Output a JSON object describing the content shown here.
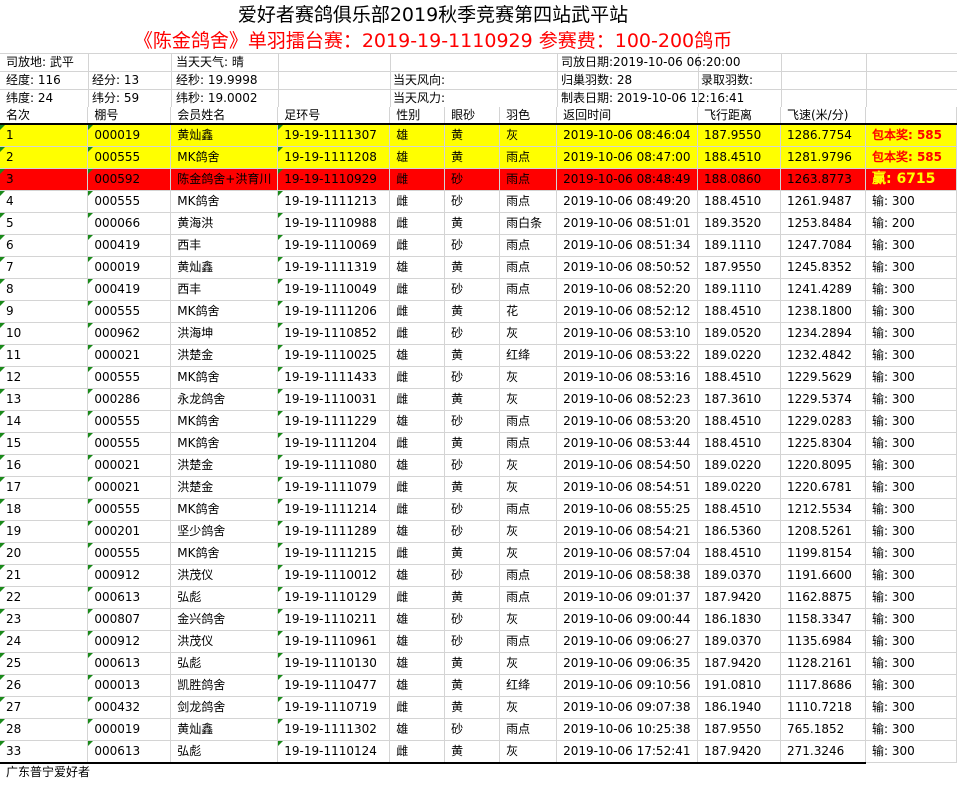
{
  "title": "爱好者赛鸽俱乐部2019秋季竞赛第四站武平站",
  "subtitle": "《陈金鸽舍》单羽擂台赛：2019-19-1110929 参赛费：100-200鸽币",
  "info": {
    "release_place": "司放地: 武平",
    "weather": "当天天气: 晴",
    "release_date": "司放日期:2019-10-06 06:20:00",
    "longitude": "经度: 116",
    "lon_min": "经分: 13",
    "lon_sec": "经秒: 19.9998",
    "wind_dir": "当天风向:",
    "returned": "归巢羽数: 28",
    "recorded": "录取羽数:",
    "latitude": "纬度:  24",
    "lat_min": "纬分: 59",
    "lat_sec": "纬秒: 19.0002",
    "wind_force": "当天风力:",
    "made_date": "制表日期: 2019-10-06 12:16:41"
  },
  "headers": [
    "名次",
    "棚号",
    "会员姓名",
    "足环号",
    "性别",
    "眼砂",
    "羽色",
    "返回时间",
    "飞行距离",
    "飞速(米/分)",
    ""
  ],
  "rows": [
    [
      "1",
      "000019",
      "黄灿鑫",
      "19-19-1111307",
      "雄",
      "黄",
      "灰",
      "2019-10-06 08:46:04",
      "187.9550",
      "1286.7754",
      "包本奖: 585"
    ],
    [
      "2",
      "000555",
      "MK鸽舍",
      "19-19-1111208",
      "雄",
      "黄",
      "雨点",
      "2019-10-06 08:47:00",
      "188.4510",
      "1281.9796",
      "包本奖: 585"
    ],
    [
      "3",
      "000592",
      "陈金鸽舍+洪育川",
      "19-19-1110929",
      "雌",
      "砂",
      "雨点",
      "2019-10-06 08:48:49",
      "188.0860",
      "1263.8773",
      "赢: 6715"
    ],
    [
      "4",
      "000555",
      "MK鸽舍",
      "19-19-1111213",
      "雌",
      "砂",
      "雨点",
      "2019-10-06 08:49:20",
      "188.4510",
      "1261.9487",
      "输: 300"
    ],
    [
      "5",
      "000066",
      "黄海洪",
      "19-19-1110988",
      "雌",
      "黄",
      "雨白条",
      "2019-10-06 08:51:01",
      "189.3520",
      "1253.8484",
      "输: 200"
    ],
    [
      "6",
      "000419",
      "西丰",
      "19-19-1110069",
      "雌",
      "砂",
      "雨点",
      "2019-10-06 08:51:34",
      "189.1110",
      "1247.7084",
      "输: 300"
    ],
    [
      "7",
      "000019",
      "黄灿鑫",
      "19-19-1111319",
      "雄",
      "黄",
      "雨点",
      "2019-10-06 08:50:52",
      "187.9550",
      "1245.8352",
      "输: 300"
    ],
    [
      "8",
      "000419",
      "西丰",
      "19-19-1110049",
      "雌",
      "砂",
      "雨点",
      "2019-10-06 08:52:20",
      "189.1110",
      "1241.4289",
      "输: 300"
    ],
    [
      "9",
      "000555",
      "MK鸽舍",
      "19-19-1111206",
      "雌",
      "黄",
      "花",
      "2019-10-06 08:52:12",
      "188.4510",
      "1238.1800",
      "输: 300"
    ],
    [
      "10",
      "000962",
      "洪海坤",
      "19-19-1110852",
      "雌",
      "砂",
      "灰",
      "2019-10-06 08:53:10",
      "189.0520",
      "1234.2894",
      "输: 300"
    ],
    [
      "11",
      "000021",
      "洪楚金",
      "19-19-1110025",
      "雄",
      "黄",
      "红绛",
      "2019-10-06 08:53:22",
      "189.0220",
      "1232.4842",
      "输: 300"
    ],
    [
      "12",
      "000555",
      "MK鸽舍",
      "19-19-1111433",
      "雌",
      "砂",
      "灰",
      "2019-10-06 08:53:16",
      "188.4510",
      "1229.5629",
      "输: 300"
    ],
    [
      "13",
      "000286",
      "永龙鸽舍",
      "19-19-1110031",
      "雌",
      "黄",
      "灰",
      "2019-10-06 08:52:23",
      "187.3610",
      "1229.5374",
      "输: 300"
    ],
    [
      "14",
      "000555",
      "MK鸽舍",
      "19-19-1111229",
      "雄",
      "砂",
      "雨点",
      "2019-10-06 08:53:20",
      "188.4510",
      "1229.0283",
      "输: 300"
    ],
    [
      "15",
      "000555",
      "MK鸽舍",
      "19-19-1111204",
      "雌",
      "黄",
      "雨点",
      "2019-10-06 08:53:44",
      "188.4510",
      "1225.8304",
      "输: 300"
    ],
    [
      "16",
      "000021",
      "洪楚金",
      "19-19-1111080",
      "雄",
      "砂",
      "灰",
      "2019-10-06 08:54:50",
      "189.0220",
      "1220.8095",
      "输: 300"
    ],
    [
      "17",
      "000021",
      "洪楚金",
      "19-19-1111079",
      "雌",
      "黄",
      "灰",
      "2019-10-06 08:54:51",
      "189.0220",
      "1220.6781",
      "输: 300"
    ],
    [
      "18",
      "000555",
      "MK鸽舍",
      "19-19-1111214",
      "雌",
      "砂",
      "雨点",
      "2019-10-06 08:55:25",
      "188.4510",
      "1212.5534",
      "输: 300"
    ],
    [
      "19",
      "000201",
      "坚少鸽舍",
      "19-19-1111289",
      "雄",
      "砂",
      "灰",
      "2019-10-06 08:54:21",
      "186.5360",
      "1208.5261",
      "输: 300"
    ],
    [
      "20",
      "000555",
      "MK鸽舍",
      "19-19-1111215",
      "雌",
      "黄",
      "灰",
      "2019-10-06 08:57:04",
      "188.4510",
      "1199.8154",
      "输: 300"
    ],
    [
      "21",
      "000912",
      "洪茂仪",
      "19-19-1110012",
      "雄",
      "砂",
      "雨点",
      "2019-10-06 08:58:38",
      "189.0370",
      "1191.6600",
      "输: 300"
    ],
    [
      "22",
      "000613",
      "弘彪",
      "19-19-1110129",
      "雌",
      "黄",
      "雨点",
      "2019-10-06 09:01:37",
      "187.9420",
      "1162.8875",
      "输: 300"
    ],
    [
      "23",
      "000807",
      "金兴鸽舍",
      "19-19-1110211",
      "雄",
      "砂",
      "灰",
      "2019-10-06 09:00:44",
      "186.1830",
      "1158.3347",
      "输: 300"
    ],
    [
      "24",
      "000912",
      "洪茂仪",
      "19-19-1110961",
      "雄",
      "砂",
      "雨点",
      "2019-10-06 09:06:27",
      "189.0370",
      "1135.6984",
      "输: 300"
    ],
    [
      "25",
      "000613",
      "弘彪",
      "19-19-1110130",
      "雄",
      "黄",
      "灰",
      "2019-10-06 09:06:35",
      "187.9420",
      "1128.2161",
      "输: 300"
    ],
    [
      "26",
      "000013",
      "凯胜鸽舍",
      "19-19-1110477",
      "雄",
      "黄",
      "红绛",
      "2019-10-06 09:10:56",
      "191.0810",
      "1117.8686",
      "输: 300"
    ],
    [
      "27",
      "000432",
      "剑龙鸽舍",
      "19-19-1110719",
      "雌",
      "黄",
      "灰",
      "2019-10-06 09:07:38",
      "186.1940",
      "1110.7218",
      "输: 300"
    ],
    [
      "28",
      "000019",
      "黄灿鑫",
      "19-19-1111302",
      "雄",
      "砂",
      "雨点",
      "2019-10-06 10:25:38",
      "187.9550",
      "765.1852",
      "输: 300"
    ],
    [
      "33",
      "000613",
      "弘彪",
      "19-19-1110124",
      "雌",
      "黄",
      "灰",
      "2019-10-06 17:52:41",
      "187.9420",
      "271.3246",
      "输: 300"
    ]
  ],
  "footer": "广东普宁爱好者"
}
